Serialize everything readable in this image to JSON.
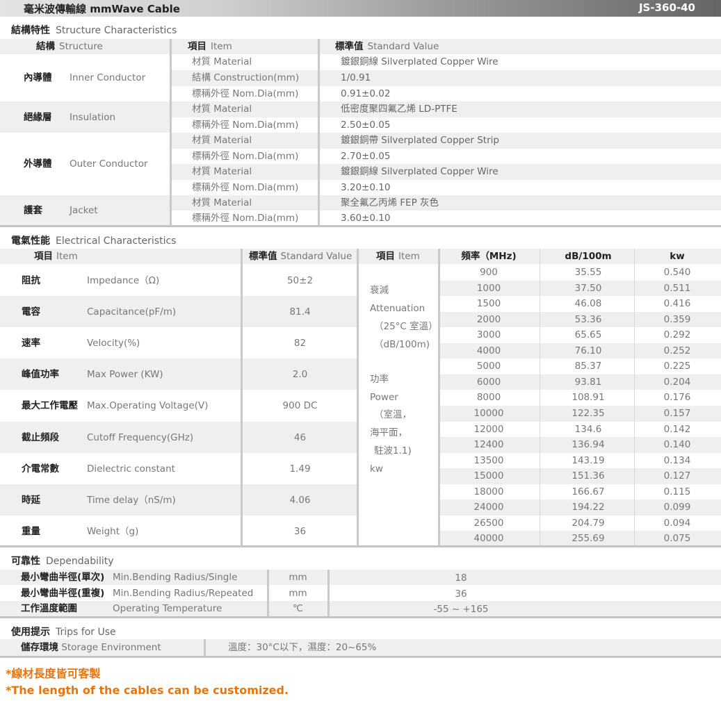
{
  "header": {
    "title": "毫米波傳輸線  mmWave Cable",
    "model": "JS-360-40"
  },
  "structure": {
    "title_zh": "結構特性",
    "title_en": "Structure Characteristics",
    "headers": {
      "structure_zh": "結構",
      "structure_en": "Structure",
      "item_zh": "項目",
      "item_en": "Item",
      "value_zh": "標準值",
      "value_en": "Standard Value"
    },
    "groups": [
      {
        "zh": "內導體",
        "en": "Inner Conductor"
      },
      {
        "zh": "絕緣層",
        "en": "Insulation"
      },
      {
        "zh": "外導體",
        "en": "Outer Conductor"
      },
      {
        "zh": "護套",
        "en": "Jacket"
      }
    ],
    "rows": [
      {
        "item": "材質  Material",
        "value": "鍍銀銅線 Silverplated Copper Wire"
      },
      {
        "item": "結構  Construction(mm)",
        "value": "1/0.91"
      },
      {
        "item": "標稱外徑  Nom.Dia(mm)",
        "value": "0.91±0.02"
      },
      {
        "item": "材質  Material",
        "value": "低密度聚四氟乙烯 LD-PTFE"
      },
      {
        "item": "標稱外徑  Nom.Dia(mm)",
        "value": "2.50±0.05"
      },
      {
        "item": "材質  Material",
        "value": "鍍銀銅帶 Silverplated Copper Strip"
      },
      {
        "item": "標稱外徑  Nom.Dia(mm)",
        "value": "2.70±0.05"
      },
      {
        "item": "材質  Material",
        "value": "鍍銀銅線 Silverplated Copper Wire"
      },
      {
        "item": "標稱外徑  Nom.Dia(mm)",
        "value": "3.20±0.10"
      },
      {
        "item": "材質  Material",
        "value": "聚全氟乙丙烯 FEP 灰色"
      },
      {
        "item": "標稱外徑  Nom.Dia(mm)",
        "value": "3.60±0.10"
      }
    ]
  },
  "electrical": {
    "title_zh": "電氣性能",
    "title_en": "Electrical Characteristics",
    "headers": {
      "item_zh": "項目",
      "item_en": "Item",
      "value_zh": "標準值",
      "value_en": "Standard Value",
      "item2_zh": "項目",
      "item2_en": "Item",
      "freq": "頻率（MHz)",
      "db": "dB/100m",
      "kw": "kw"
    },
    "props": [
      {
        "zh": "阻抗",
        "en": "Impedance（Ω)",
        "value": "50±2"
      },
      {
        "zh": "電容",
        "en": "Capacitance(pF/m)",
        "value": "81.4"
      },
      {
        "zh": "速率",
        "en": "Velocity(%)",
        "value": "82"
      },
      {
        "zh": "峰值功率",
        "en": "Max Power (KW)",
        "value": "2.0"
      },
      {
        "zh": "最大工作電壓",
        "en": "Max.Operating Voltage(V)",
        "value": "900 DC"
      },
      {
        "zh": "截止頻段",
        "en": "Cutoff Frequency(GHz)",
        "value": "46"
      },
      {
        "zh": "介電常數",
        "en": "Dielectric constant",
        "value": "1.49"
      },
      {
        "zh": "時延",
        "en": "Time delay（nS/m)",
        "value": "4.06"
      },
      {
        "zh": "重量",
        "en": "Weight（g)",
        "value": "36"
      }
    ],
    "attenuation_label": [
      "衰減",
      "Attenuation",
      "（25°C 室溫）",
      "（dB/100m)"
    ],
    "power_label": [
      "功率",
      "Power",
      "（室溫，",
      "海平面，",
      "駐波1.1)",
      "kw"
    ],
    "table": [
      {
        "freq": "900",
        "db": "35.55",
        "kw": "0.540"
      },
      {
        "freq": "1000",
        "db": "37.50",
        "kw": "0.511"
      },
      {
        "freq": "1500",
        "db": "46.08",
        "kw": "0.416"
      },
      {
        "freq": "2000",
        "db": "53.36",
        "kw": "0.359"
      },
      {
        "freq": "3000",
        "db": "65.65",
        "kw": "0.292"
      },
      {
        "freq": "4000",
        "db": "76.10",
        "kw": "0.252"
      },
      {
        "freq": "5000",
        "db": "85.37",
        "kw": "0.225"
      },
      {
        "freq": "6000",
        "db": "93.81",
        "kw": "0.204"
      },
      {
        "freq": "8000",
        "db": "108.91",
        "kw": "0.176"
      },
      {
        "freq": "10000",
        "db": "122.35",
        "kw": "0.157"
      },
      {
        "freq": "12000",
        "db": "134.6",
        "kw": "0.142"
      },
      {
        "freq": "12400",
        "db": "136.94",
        "kw": "0.140"
      },
      {
        "freq": "13500",
        "db": "143.19",
        "kw": "0.134"
      },
      {
        "freq": "15000",
        "db": "151.36",
        "kw": "0.127"
      },
      {
        "freq": "18000",
        "db": "166.67",
        "kw": "0.115"
      },
      {
        "freq": "24000",
        "db": "194.22",
        "kw": "0.099"
      },
      {
        "freq": "26500",
        "db": "204.79",
        "kw": "0.094"
      },
      {
        "freq": "40000",
        "db": "255.69",
        "kw": "0.075"
      }
    ]
  },
  "dependability": {
    "title_zh": "可靠性",
    "title_en": "Dependability",
    "rows": [
      {
        "zh": "最小彎曲半徑(單次)",
        "en": "Min.Bending Radius/Single",
        "unit": "mm",
        "value": "18"
      },
      {
        "zh": "最小彎曲半徑(重複)",
        "en": "Min.Bending Radius/Repeated",
        "unit": "mm",
        "value": "36"
      },
      {
        "zh": "工作溫度範圍",
        "en": "Operating Temperature",
        "unit": "℃",
        "value": "-55 ~ +165"
      }
    ]
  },
  "tips": {
    "title_zh": "使用提示",
    "title_en": "Trips for Use",
    "row": {
      "zh": "儲存環境",
      "en": "Storage Environment",
      "value": "溫度：30°C以下，濕度：20~65%"
    }
  },
  "notes": {
    "zh": "*線材長度皆可客製",
    "en": "*The length of the cables can be customized."
  }
}
